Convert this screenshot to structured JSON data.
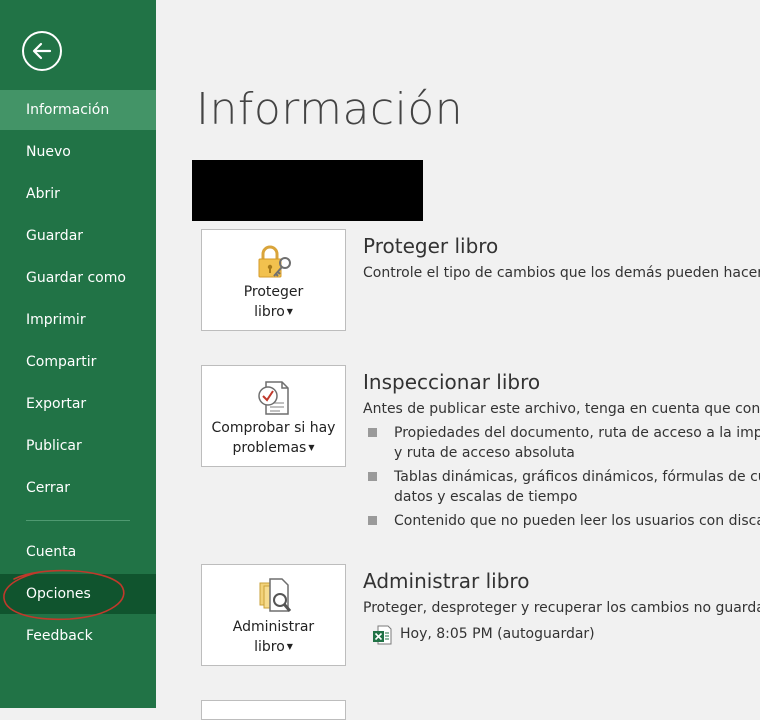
{
  "sidebar": {
    "back_icon": "arrow-left-icon",
    "items": [
      {
        "label": "Información"
      },
      {
        "label": "Nuevo"
      },
      {
        "label": "Abrir"
      },
      {
        "label": "Guardar"
      },
      {
        "label": "Guardar como"
      },
      {
        "label": "Imprimir"
      },
      {
        "label": "Compartir"
      },
      {
        "label": "Exportar"
      },
      {
        "label": "Publicar"
      },
      {
        "label": "Cerrar"
      },
      {
        "label": "Cuenta"
      },
      {
        "label": "Opciones"
      },
      {
        "label": "Feedback"
      }
    ],
    "active_item": "Información",
    "highlighted_item": "Opciones"
  },
  "main": {
    "title": "Información",
    "protect": {
      "button_line1": "Proteger",
      "button_line2": "libro",
      "title": "Proteger libro",
      "description": "Controle el tipo de cambios que los demás pueden hacer en"
    },
    "inspect": {
      "button_line1": "Comprobar si hay",
      "button_line2": "problemas",
      "title": "Inspeccionar libro",
      "description": "Antes de publicar este archivo, tenga en cuenta que contiene",
      "bullets": [
        {
          "line1": "Propiedades del documento, ruta de acceso a la impres",
          "line2": "y ruta de acceso absoluta"
        },
        {
          "line1": "Tablas dinámicas, gráficos dinámicos, fórmulas de cubo",
          "line2": "datos y escalas de tiempo"
        },
        {
          "line1": "Contenido que no pueden leer los usuarios con discapa",
          "line2": ""
        }
      ]
    },
    "manage": {
      "button_line1": "Administrar",
      "button_line2": "libro",
      "title": "Administrar libro",
      "description": "Proteger, desproteger y recuperar los cambios no guardados",
      "version": "Hoy, 8:05 PM (autoguardar)"
    }
  },
  "colors": {
    "sidebar_bg": "#217346",
    "active_bg": "#439467",
    "highlight_ellipse": "#c0392b"
  }
}
